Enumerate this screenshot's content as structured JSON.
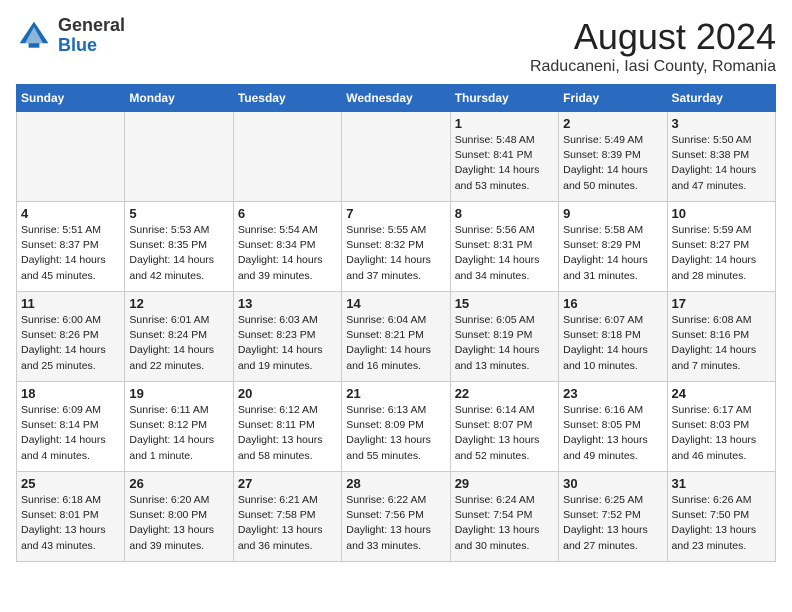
{
  "header": {
    "logo_general": "General",
    "logo_blue": "Blue",
    "month_title": "August 2024",
    "subtitle": "Raducaneni, Iasi County, Romania"
  },
  "weekdays": [
    "Sunday",
    "Monday",
    "Tuesday",
    "Wednesday",
    "Thursday",
    "Friday",
    "Saturday"
  ],
  "weeks": [
    [
      {
        "day": "",
        "info": ""
      },
      {
        "day": "",
        "info": ""
      },
      {
        "day": "",
        "info": ""
      },
      {
        "day": "",
        "info": ""
      },
      {
        "day": "1",
        "info": "Sunrise: 5:48 AM\nSunset: 8:41 PM\nDaylight: 14 hours\nand 53 minutes."
      },
      {
        "day": "2",
        "info": "Sunrise: 5:49 AM\nSunset: 8:39 PM\nDaylight: 14 hours\nand 50 minutes."
      },
      {
        "day": "3",
        "info": "Sunrise: 5:50 AM\nSunset: 8:38 PM\nDaylight: 14 hours\nand 47 minutes."
      }
    ],
    [
      {
        "day": "4",
        "info": "Sunrise: 5:51 AM\nSunset: 8:37 PM\nDaylight: 14 hours\nand 45 minutes."
      },
      {
        "day": "5",
        "info": "Sunrise: 5:53 AM\nSunset: 8:35 PM\nDaylight: 14 hours\nand 42 minutes."
      },
      {
        "day": "6",
        "info": "Sunrise: 5:54 AM\nSunset: 8:34 PM\nDaylight: 14 hours\nand 39 minutes."
      },
      {
        "day": "7",
        "info": "Sunrise: 5:55 AM\nSunset: 8:32 PM\nDaylight: 14 hours\nand 37 minutes."
      },
      {
        "day": "8",
        "info": "Sunrise: 5:56 AM\nSunset: 8:31 PM\nDaylight: 14 hours\nand 34 minutes."
      },
      {
        "day": "9",
        "info": "Sunrise: 5:58 AM\nSunset: 8:29 PM\nDaylight: 14 hours\nand 31 minutes."
      },
      {
        "day": "10",
        "info": "Sunrise: 5:59 AM\nSunset: 8:27 PM\nDaylight: 14 hours\nand 28 minutes."
      }
    ],
    [
      {
        "day": "11",
        "info": "Sunrise: 6:00 AM\nSunset: 8:26 PM\nDaylight: 14 hours\nand 25 minutes."
      },
      {
        "day": "12",
        "info": "Sunrise: 6:01 AM\nSunset: 8:24 PM\nDaylight: 14 hours\nand 22 minutes."
      },
      {
        "day": "13",
        "info": "Sunrise: 6:03 AM\nSunset: 8:23 PM\nDaylight: 14 hours\nand 19 minutes."
      },
      {
        "day": "14",
        "info": "Sunrise: 6:04 AM\nSunset: 8:21 PM\nDaylight: 14 hours\nand 16 minutes."
      },
      {
        "day": "15",
        "info": "Sunrise: 6:05 AM\nSunset: 8:19 PM\nDaylight: 14 hours\nand 13 minutes."
      },
      {
        "day": "16",
        "info": "Sunrise: 6:07 AM\nSunset: 8:18 PM\nDaylight: 14 hours\nand 10 minutes."
      },
      {
        "day": "17",
        "info": "Sunrise: 6:08 AM\nSunset: 8:16 PM\nDaylight: 14 hours\nand 7 minutes."
      }
    ],
    [
      {
        "day": "18",
        "info": "Sunrise: 6:09 AM\nSunset: 8:14 PM\nDaylight: 14 hours\nand 4 minutes."
      },
      {
        "day": "19",
        "info": "Sunrise: 6:11 AM\nSunset: 8:12 PM\nDaylight: 14 hours\nand 1 minute."
      },
      {
        "day": "20",
        "info": "Sunrise: 6:12 AM\nSunset: 8:11 PM\nDaylight: 13 hours\nand 58 minutes."
      },
      {
        "day": "21",
        "info": "Sunrise: 6:13 AM\nSunset: 8:09 PM\nDaylight: 13 hours\nand 55 minutes."
      },
      {
        "day": "22",
        "info": "Sunrise: 6:14 AM\nSunset: 8:07 PM\nDaylight: 13 hours\nand 52 minutes."
      },
      {
        "day": "23",
        "info": "Sunrise: 6:16 AM\nSunset: 8:05 PM\nDaylight: 13 hours\nand 49 minutes."
      },
      {
        "day": "24",
        "info": "Sunrise: 6:17 AM\nSunset: 8:03 PM\nDaylight: 13 hours\nand 46 minutes."
      }
    ],
    [
      {
        "day": "25",
        "info": "Sunrise: 6:18 AM\nSunset: 8:01 PM\nDaylight: 13 hours\nand 43 minutes."
      },
      {
        "day": "26",
        "info": "Sunrise: 6:20 AM\nSunset: 8:00 PM\nDaylight: 13 hours\nand 39 minutes."
      },
      {
        "day": "27",
        "info": "Sunrise: 6:21 AM\nSunset: 7:58 PM\nDaylight: 13 hours\nand 36 minutes."
      },
      {
        "day": "28",
        "info": "Sunrise: 6:22 AM\nSunset: 7:56 PM\nDaylight: 13 hours\nand 33 minutes."
      },
      {
        "day": "29",
        "info": "Sunrise: 6:24 AM\nSunset: 7:54 PM\nDaylight: 13 hours\nand 30 minutes."
      },
      {
        "day": "30",
        "info": "Sunrise: 6:25 AM\nSunset: 7:52 PM\nDaylight: 13 hours\nand 27 minutes."
      },
      {
        "day": "31",
        "info": "Sunrise: 6:26 AM\nSunset: 7:50 PM\nDaylight: 13 hours\nand 23 minutes."
      }
    ]
  ]
}
